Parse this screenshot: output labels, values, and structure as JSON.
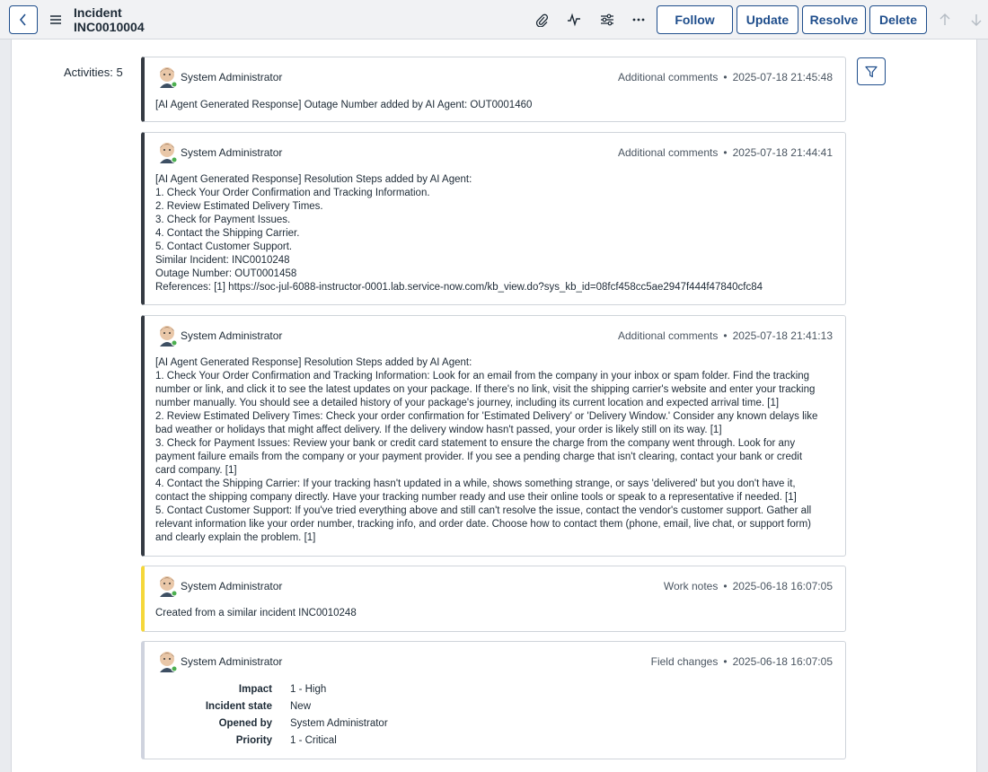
{
  "header": {
    "title": "Incident",
    "number": "INC0010004",
    "buttons": {
      "follow": "Follow",
      "update": "Update",
      "resolve": "Resolve",
      "delete": "Delete"
    }
  },
  "activities": {
    "label": "Activities: 5",
    "items": [
      {
        "author": "System Administrator",
        "type": "Additional comments",
        "timestamp": "2025-07-18 21:45:48",
        "lines": [
          "[AI Agent Generated Response] Outage Number added by AI Agent: OUT0001460"
        ]
      },
      {
        "author": "System Administrator",
        "type": "Additional comments",
        "timestamp": "2025-07-18 21:44:41",
        "lines": [
          "[AI Agent Generated Response] Resolution Steps added by AI Agent:",
          "1. Check Your Order Confirmation and Tracking Information.",
          "2. Review Estimated Delivery Times.",
          "3. Check for Payment Issues.",
          "4. Contact the Shipping Carrier.",
          "5. Contact Customer Support.",
          "Similar Incident: INC0010248",
          "Outage Number: OUT0001458",
          "References: [1] https://soc-jul-6088-instructor-0001.lab.service-now.com/kb_view.do?sys_kb_id=08fcf458cc5ae2947f444f47840cfc84"
        ]
      },
      {
        "author": "System Administrator",
        "type": "Additional comments",
        "timestamp": "2025-07-18 21:41:13",
        "lines": [
          "[AI Agent Generated Response] Resolution Steps added by AI Agent:",
          "1. Check Your Order Confirmation and Tracking Information: Look for an email from the company in your inbox or spam folder. Find the tracking",
          "number or link, and click it to see the latest updates on your package. If there's no link, visit the shipping carrier's website and enter your tracking",
          "number manually. You should see a detailed history of your package's journey, including its current location and expected arrival time. [1]",
          "2. Review Estimated Delivery Times: Check your order confirmation for 'Estimated Delivery' or 'Delivery Window.' Consider any known delays like",
          "bad weather or holidays that might affect delivery. If the delivery window hasn't passed, your order is likely still on its way. [1]",
          "3. Check for Payment Issues: Review your bank or credit card statement to ensure the charge from the company went through. Look for any",
          "payment failure emails from the company or your payment provider. If you see a pending charge that isn't clearing, contact your bank or credit",
          "card company. [1]",
          "4. Contact the Shipping Carrier: If your tracking hasn't updated in a while, shows something strange, or says 'delivered' but you don't have it,",
          "contact the shipping company directly. Have your tracking number ready and use their online tools or speak to a representative if needed. [1]",
          "5. Contact Customer Support: If you've tried everything above and still can't resolve the issue, contact the vendor's customer support. Gather all",
          "relevant information like your order number, tracking info, and order date. Choose how to contact them (phone, email, live chat, or support form)",
          "and clearly explain the problem. [1]"
        ]
      },
      {
        "author": "System Administrator",
        "type": "Work notes",
        "timestamp": "2025-06-18 16:07:05",
        "lines": [
          "Created from a similar incident INC0010248"
        ]
      },
      {
        "author": "System Administrator",
        "type": "Field changes",
        "timestamp": "2025-06-18 16:07:05",
        "fields": [
          {
            "name": "Impact",
            "value": "1 - High"
          },
          {
            "name": "Incident state",
            "value": "New"
          },
          {
            "name": "Opened by",
            "value": "System Administrator"
          },
          {
            "name": "Priority",
            "value": "1 - Critical"
          }
        ]
      }
    ]
  },
  "colors": {
    "accent": "#1f4e8c",
    "worknote_bar": "#f5d73a",
    "comment_bar": "#343a42",
    "fieldchange_bar": "#cfd3de",
    "presence": "#4caf50"
  },
  "icons": [
    "chevron-left-icon",
    "hamburger-menu-icon",
    "paperclip-icon",
    "activity-pulse-icon",
    "sliders-icon",
    "more-icon",
    "arrow-up-icon",
    "arrow-down-icon",
    "filter-icon",
    "avatar"
  ]
}
